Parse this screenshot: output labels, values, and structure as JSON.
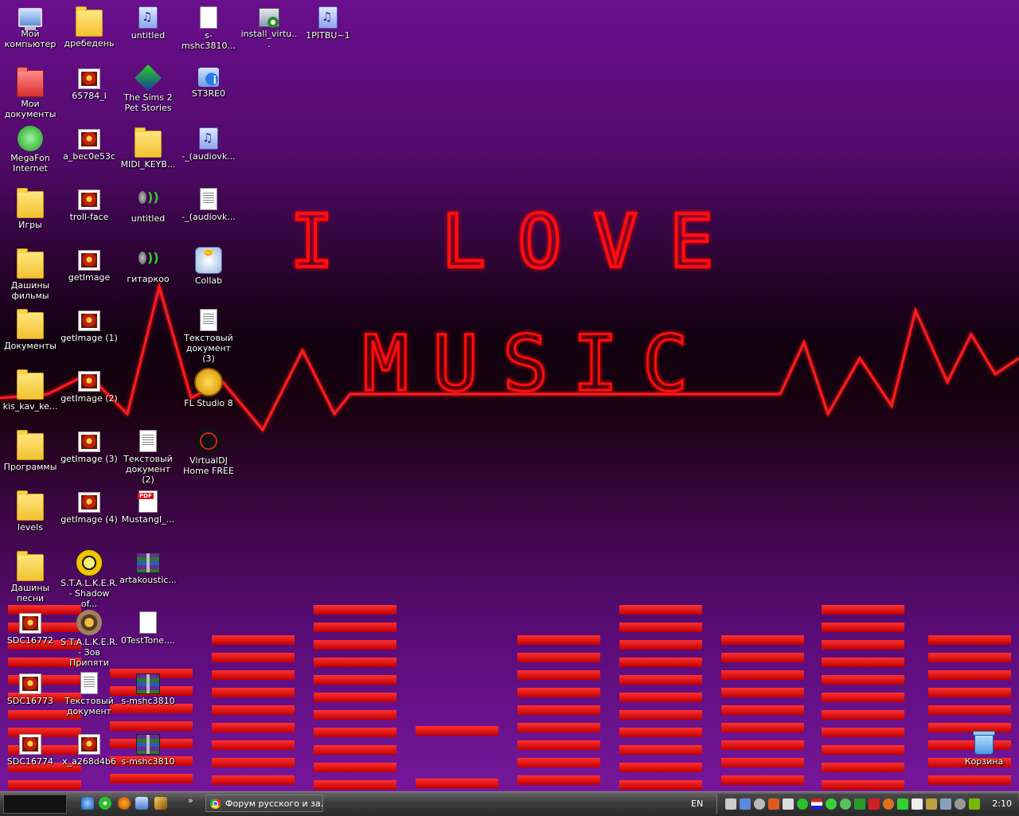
{
  "wallpaper": {
    "line1": "I LOVE",
    "line2": "MUSIC"
  },
  "icons": [
    {
      "label": "Мой компьютер",
      "type": "pc"
    },
    {
      "label": "дребедень",
      "type": "folder"
    },
    {
      "label": "untitled",
      "type": "music"
    },
    {
      "label": "s-mshc3810...",
      "type": "doc"
    },
    {
      "label": "install_virtu...",
      "type": "setup"
    },
    {
      "label": "1PITBU~1",
      "type": "music"
    },
    {
      "label": "Мои документы",
      "type": "folder-red"
    },
    {
      "label": "65784_l",
      "type": "photo"
    },
    {
      "label": "The Sims 2 Pet Stories",
      "type": "sims"
    },
    {
      "label": "ST3RE0",
      "type": "info"
    },
    {
      "label": "MegaFon Internet",
      "type": "round-green"
    },
    {
      "label": "a_bec0e53c",
      "type": "photo"
    },
    {
      "label": "MIDI_KEYB...",
      "type": "folder"
    },
    {
      "label": "-_(audiovk...",
      "type": "music"
    },
    {
      "label": "Игры",
      "type": "folder"
    },
    {
      "label": "troll-face",
      "type": "photo"
    },
    {
      "label": "untitled",
      "type": "speaker"
    },
    {
      "label": "-_(audiovk...",
      "type": "doc-text"
    },
    {
      "label": "Дашины фильмы",
      "type": "folder"
    },
    {
      "label": "getImage",
      "type": "photo"
    },
    {
      "label": "гитаркоо",
      "type": "speaker"
    },
    {
      "label": "Collab",
      "type": "collab"
    },
    {
      "label": "Документы",
      "type": "folder"
    },
    {
      "label": "getImage (1)",
      "type": "photo"
    },
    {
      "label": "Текстовый документ (3)",
      "type": "doc-text"
    },
    {
      "label": "kis_kav_ke...",
      "type": "folder"
    },
    {
      "label": "getImage (2)",
      "type": "photo"
    },
    {
      "label": "FL Studio 8",
      "type": "fl"
    },
    {
      "label": "Программы",
      "type": "folder"
    },
    {
      "label": "getImage (3)",
      "type": "photo"
    },
    {
      "label": "Текстовый документ (2)",
      "type": "doc-text"
    },
    {
      "label": "VirtualDJ Home FREE",
      "type": "vdj"
    },
    {
      "label": "levels",
      "type": "folder"
    },
    {
      "label": "getImage (4)",
      "type": "photo"
    },
    {
      "label": "MustangI_...",
      "type": "pdf"
    },
    {
      "label": "Дашины песни",
      "type": "folder"
    },
    {
      "label": "S.T.A.L.K.E.R. - Shadow of...",
      "type": "round-yellow"
    },
    {
      "label": "artakoustic...",
      "type": "rar"
    },
    {
      "label": "SDC16772",
      "type": "photo"
    },
    {
      "label": "S.T.A.L.K.E.R. - Зов Припяти",
      "type": "round-rad"
    },
    {
      "label": "0TestTone....",
      "type": "doc"
    },
    {
      "label": "SDC16773",
      "type": "photo"
    },
    {
      "label": "Текстовый документ",
      "type": "doc-text"
    },
    {
      "label": "s-mshc3810",
      "type": "rar"
    },
    {
      "label": "SDC16774",
      "type": "photo"
    },
    {
      "label": "x_a268d4b6",
      "type": "photo"
    },
    {
      "label": "s-mshc3810",
      "type": "rar"
    },
    {
      "label": "Корзина",
      "type": "trash"
    }
  ],
  "taskbar": {
    "quicklaunch": [
      "ie-icon",
      "flower-icon",
      "firefox-icon",
      "window-icon",
      "winamp-icon"
    ],
    "chevron": "»",
    "task_label": "Форум русского и за...",
    "language": "EN",
    "clock": "2:10",
    "colors": {
      "accent": "#ff0000",
      "wallpaper_purple": "#6a0f8e"
    }
  }
}
